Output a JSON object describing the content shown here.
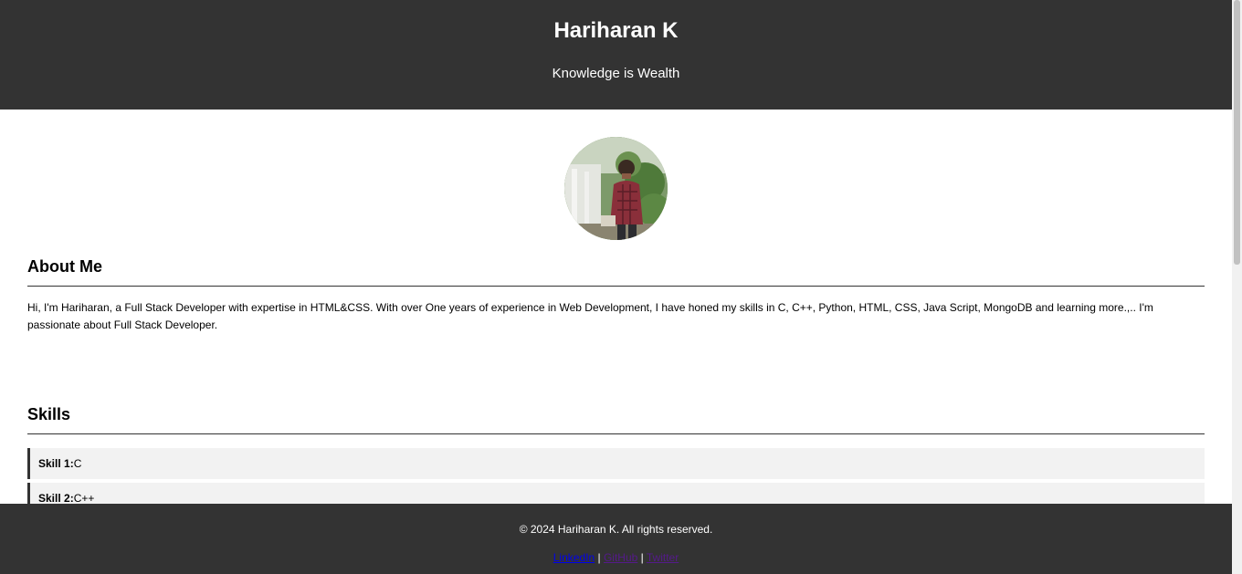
{
  "header": {
    "name": "Hariharan K",
    "tagline": "Knowledge is Wealth"
  },
  "about": {
    "heading": "About Me",
    "text": "Hi, I'm Hariharan, a Full Stack Developer with expertise in HTML&CSS. With over One years of experience in Web Development, I have honed my skills in C, C++, Python, HTML, CSS, Java Script, MongoDB and learning more.,.. I'm passionate about Full Stack Developer."
  },
  "skills": {
    "heading": "Skills",
    "items": [
      {
        "label": "Skill 1:",
        "value": "C"
      },
      {
        "label": "Skill 2:",
        "value": "C++"
      }
    ]
  },
  "footer": {
    "copyright": "© 2024 Hariharan K. All rights reserved.",
    "separator": "|",
    "links": [
      "LinkedIn",
      "GitHub",
      "Twitter"
    ]
  },
  "colors": {
    "header_bg": "#333333",
    "footer_bg": "#333333",
    "skill_bg": "#f2f2f2",
    "link": "#0000ee",
    "link_visited": "#551a8b"
  }
}
